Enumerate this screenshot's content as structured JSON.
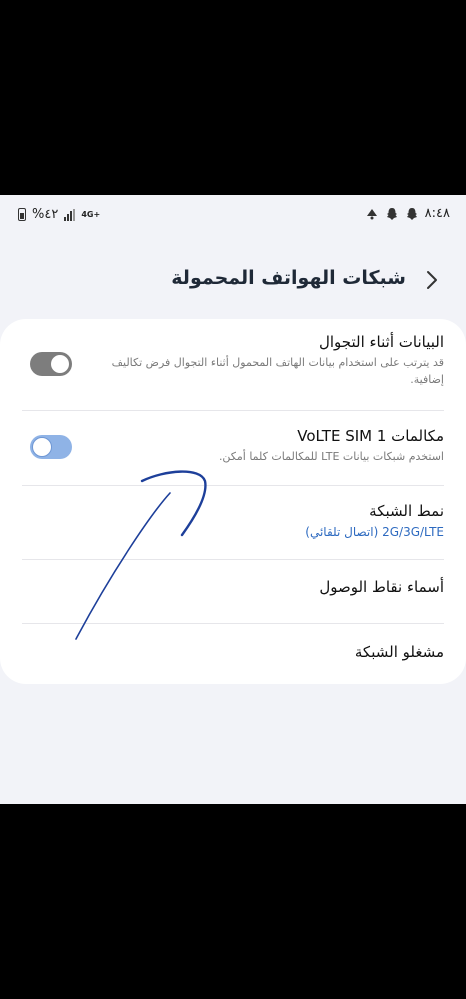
{
  "status_bar": {
    "time": "٨:٤٨",
    "battery_percent": "%٤٢",
    "network_type": "4G+",
    "left_icons": [
      "battery-icon",
      "signal-icon",
      "network-type-icon"
    ],
    "right_icons": [
      "snapchat-icon",
      "snapchat-icon",
      "mute-icon"
    ]
  },
  "header": {
    "title": "شبكات الهواتف المحمولة",
    "back_icon": "chevron-left-icon"
  },
  "settings": [
    {
      "title": "البيانات أثناء التجوال",
      "subtitle": "قد يترتب على استخدام بيانات الهاتف المحمول أثناء التجوال فرض تكاليف إضافية.",
      "toggle_on": false
    },
    {
      "title": "مكالمات VoLTE SIM 1",
      "subtitle": "استخدم شبكات بيانات LTE للمكالمات كلما أمكن.",
      "toggle_on": false
    },
    {
      "title": "نمط الشبكة",
      "value": "2G/3G/LTE (اتصال تلقائي)"
    },
    {
      "title": "أسماء نقاط الوصول"
    },
    {
      "title": "مشغلو الشبكة"
    }
  ],
  "colors": {
    "accent": "#2d6ac0",
    "background": "#f2f3f8",
    "annotation_ink": "#1d3f9a"
  }
}
